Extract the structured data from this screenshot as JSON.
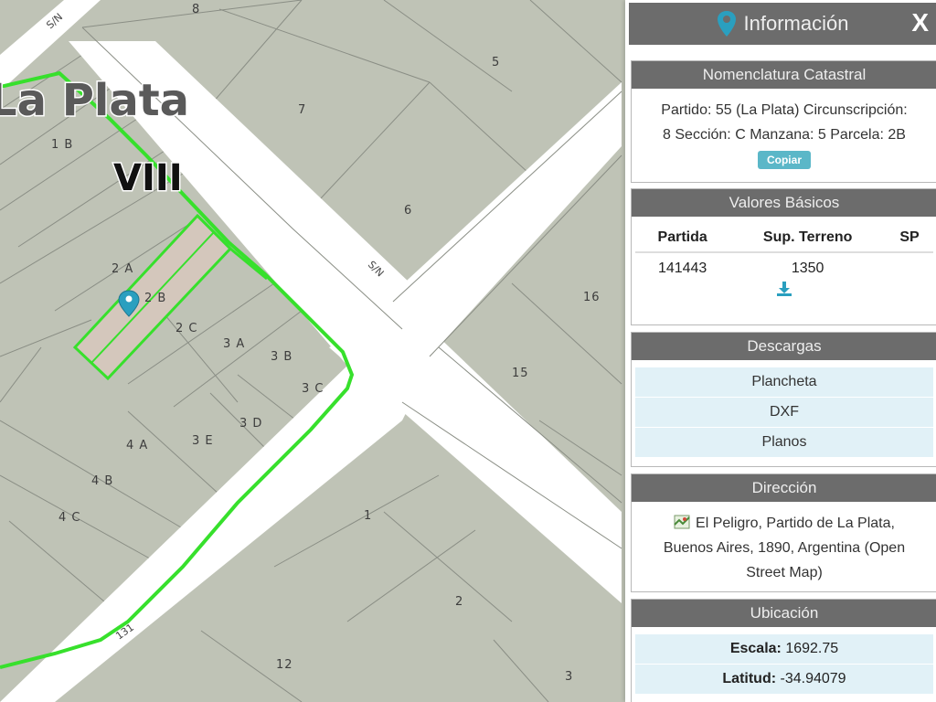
{
  "map": {
    "city_label": "La Plata",
    "circunscripcion_label": "VIII",
    "street_labels": [
      "S/N",
      "S/N",
      "131"
    ],
    "parcels": [
      "8",
      "5",
      "7",
      "1 B",
      "6",
      "2 A",
      "2 B",
      "2 C",
      "16",
      "3 A",
      "3 B",
      "3 C",
      "15",
      "3 D",
      "3 E",
      "4 A",
      "4 B",
      "4 C",
      "1",
      "2",
      "12",
      "3"
    ],
    "colors": {
      "parcel": "#bfc3b6",
      "road": "#ffffff",
      "boundary": "#37e02c",
      "selected": "#d4c7bc",
      "marker": "#2a9fbf"
    }
  },
  "panel": {
    "title": "Información",
    "close": "X",
    "nomenclatura": {
      "title": "Nomenclatura Catastral",
      "line1": "Partido: 55 (La Plata) Circunscripción:",
      "line2": "8 Sección: C Manzana: 5 Parcela: 2B",
      "copy_label": "Copiar"
    },
    "valores": {
      "title": "Valores Básicos",
      "headers": [
        "Partida",
        "Sup. Terreno",
        "SP"
      ],
      "row": [
        "141443",
        "1350",
        ""
      ]
    },
    "descargas": {
      "title": "Descargas",
      "items": [
        "Plancheta",
        "DXF",
        "Planos"
      ]
    },
    "direccion": {
      "title": "Dirección",
      "line1": "El Peligro, Partido de La Plata,",
      "line2": "Buenos Aires, 1890, Argentina (Open",
      "line3": "Street Map)"
    },
    "ubicacion": {
      "title": "Ubicación",
      "escala_label": "Escala:",
      "escala_value": "1692.75",
      "latitud_label": "Latitud:",
      "latitud_value": "-34.94079"
    }
  }
}
